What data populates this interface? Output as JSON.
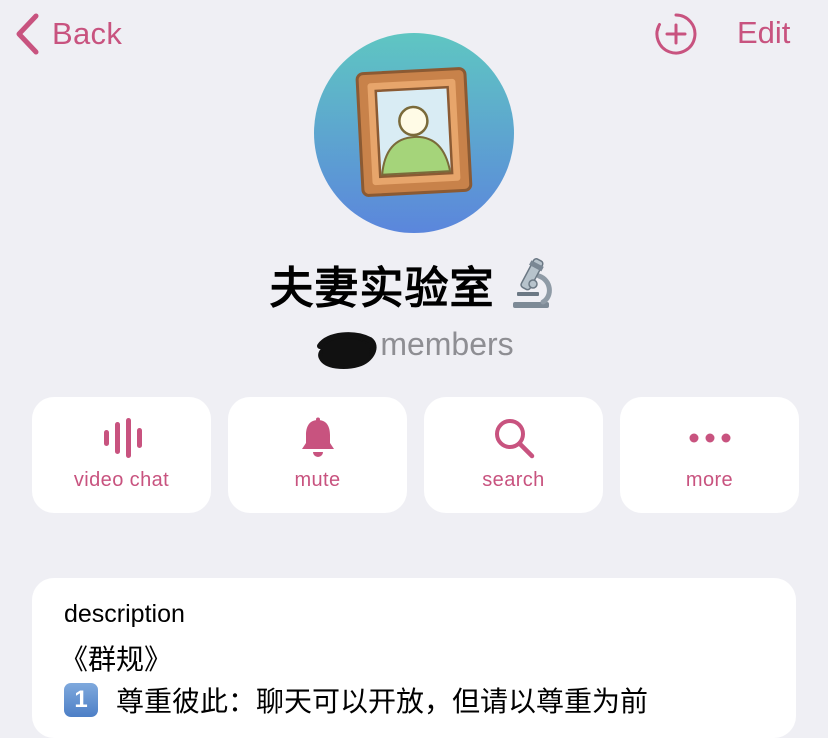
{
  "nav": {
    "back_label": "Back",
    "edit_label": "Edit",
    "add_icon": "add-circle-icon",
    "accent_color": "#c8537f"
  },
  "profile": {
    "title": "夫妻实验室",
    "title_emoji": "microscope",
    "members_label": "members",
    "members_count_redacted": true,
    "avatar_icon": "picture-frame-icon"
  },
  "actions": [
    {
      "label": "video chat",
      "icon": "voice-wave-icon"
    },
    {
      "label": "mute",
      "icon": "bell-icon"
    },
    {
      "label": "search",
      "icon": "search-icon"
    },
    {
      "label": "more",
      "icon": "ellipsis-icon"
    }
  ],
  "description": {
    "heading": "description",
    "line1": "《群规》",
    "line2_badge": "1",
    "line2": "尊重彼此：聊天可以开放，但请以尊重为前"
  }
}
